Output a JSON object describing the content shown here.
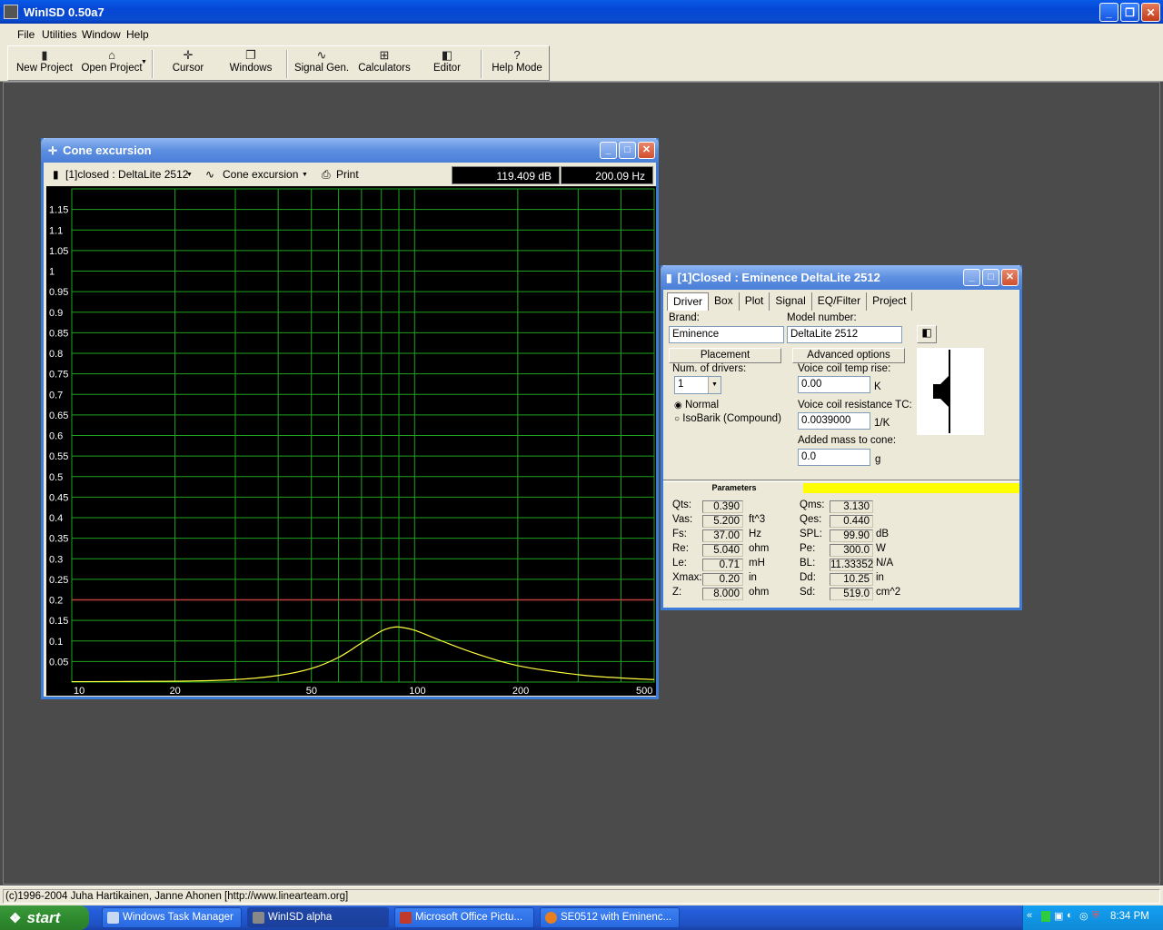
{
  "app": {
    "title": "WinISD 0.50a7"
  },
  "menu": {
    "items": [
      "File",
      "Utilities",
      "Window",
      "Help"
    ]
  },
  "toolbar": {
    "buttons": [
      {
        "label": "New Project",
        "icon": "new-project-icon"
      },
      {
        "label": "Open Project",
        "icon": "open-folder-icon"
      },
      {
        "label": "Cursor",
        "icon": "cursor-crosshair-icon"
      },
      {
        "label": "Windows",
        "icon": "windows-stack-icon"
      },
      {
        "label": "Signal Gen.",
        "icon": "sine-wave-icon"
      },
      {
        "label": "Calculators",
        "icon": "calculator-icon"
      },
      {
        "label": "Editor",
        "icon": "speaker-editor-icon"
      },
      {
        "label": "Help Mode",
        "icon": "help-question-icon"
      }
    ]
  },
  "cone_window": {
    "title": "Cone excursion",
    "project_select": "[1]closed : DeltaLite 2512",
    "graph_select": "Cone excursion",
    "print_label": "Print",
    "readout_db": "119.409 dB",
    "readout_hz": "200.09 Hz"
  },
  "chart_data": {
    "type": "line",
    "title": "",
    "xlabel": "",
    "ylabel": "",
    "x_scale": "log",
    "xlim": [
      10,
      500
    ],
    "ylim": [
      0,
      1.2
    ],
    "x_tick_labels": [
      "10",
      "20",
      "50",
      "100",
      "200",
      "500"
    ],
    "x_ticks": [
      10,
      20,
      50,
      100,
      200,
      500
    ],
    "y_ticks": [
      1.15,
      1.1,
      1.05,
      1,
      0.95,
      0.9,
      0.85,
      0.8,
      0.75,
      0.7,
      0.65,
      0.6,
      0.55,
      0.5,
      0.45,
      0.4,
      0.35,
      0.3,
      0.25,
      0.2,
      0.15,
      0.1,
      0.05
    ],
    "y_tick_labels": [
      "1.15",
      "1.1",
      "1.05",
      "1",
      "0.95",
      "0.9",
      "0.85",
      "0.8",
      "0.75",
      "0.7",
      "0.65",
      "0.6",
      "0.55",
      "0.5",
      "0.45",
      "0.4",
      "0.35",
      "0.3",
      "0.25",
      "0.2",
      "0.15",
      "0.1",
      "0.05"
    ],
    "grid": true,
    "limit_line": {
      "y": 0.2,
      "color": "#c04040"
    },
    "series": [
      {
        "color": "#ffff40",
        "x": [
          10,
          20,
          30,
          40,
          50,
          60,
          70,
          80,
          85,
          90,
          100,
          120,
          150,
          200,
          300,
          400,
          500
        ],
        "y": [
          0.001,
          0.002,
          0.006,
          0.016,
          0.033,
          0.06,
          0.095,
          0.124,
          0.132,
          0.134,
          0.126,
          0.1,
          0.07,
          0.04,
          0.018,
          0.01,
          0.006
        ]
      }
    ],
    "colors": {
      "background": "#000000",
      "grid": "#1fa31f",
      "axis_text": "#ffffff"
    }
  },
  "driver_window": {
    "title": "[1]Closed : Eminence  DeltaLite 2512",
    "tabs": [
      "Driver",
      "Box",
      "Plot",
      "Signal",
      "EQ/Filter",
      "Project"
    ],
    "active_tab": "Driver",
    "brand_label": "Brand:",
    "brand_value": "Eminence",
    "model_label": "Model number:",
    "model_value": "DeltaLite 2512",
    "placement_label": "Placement",
    "advanced_label": "Advanced options",
    "num_drivers_label": "Num. of drivers:",
    "num_drivers_value": "1",
    "radio_normal": "Normal",
    "radio_isobarik": "IsoBarik (Compound)",
    "vc_temp_label": "Voice coil temp rise:",
    "vc_temp_value": "0.00",
    "vc_temp_unit": "K",
    "vc_tc_label": "Voice coil resistance TC:",
    "vc_tc_value": "0.0039000",
    "vc_tc_unit": "1/K",
    "added_mass_label": "Added mass to cone:",
    "added_mass_value": "0.0",
    "added_mass_unit": "g",
    "params_header": "Parameters",
    "params_left": [
      {
        "name": "Qts:",
        "value": "0.390",
        "unit": ""
      },
      {
        "name": "Vas:",
        "value": "5.200",
        "unit": "ft^3"
      },
      {
        "name": "Fs:",
        "value": "37.00",
        "unit": "Hz"
      },
      {
        "name": "Re:",
        "value": "5.040",
        "unit": "ohm"
      },
      {
        "name": "Le:",
        "value": "0.71",
        "unit": "mH"
      },
      {
        "name": "Xmax:",
        "value": "0.20",
        "unit": "in"
      },
      {
        "name": "Z:",
        "value": "8.000",
        "unit": "ohm"
      }
    ],
    "params_right": [
      {
        "name": "Qms:",
        "value": "3.130",
        "unit": ""
      },
      {
        "name": "Qes:",
        "value": "0.440",
        "unit": ""
      },
      {
        "name": "SPL:",
        "value": "99.90",
        "unit": "dB"
      },
      {
        "name": "Pe:",
        "value": "300.0",
        "unit": "W"
      },
      {
        "name": "BL:",
        "value": "11.33352",
        "unit": "N/A"
      },
      {
        "name": "Dd:",
        "value": "10.25",
        "unit": "in"
      },
      {
        "name": "Sd:",
        "value": "519.0",
        "unit": "cm^2"
      }
    ]
  },
  "status": {
    "text": "(c)1996-2004 Juha Hartikainen, Janne Ahonen [http://www.linearteam.org]"
  },
  "taskbar": {
    "start_label": "start",
    "tasks": [
      {
        "label": "Windows Task Manager",
        "icon": "task-manager-icon"
      },
      {
        "label": "WinISD alpha",
        "icon": "winisd-icon"
      },
      {
        "label": "Microsoft Office Pictu...",
        "icon": "office-picture-icon"
      },
      {
        "label": "SE0512 with Eminenc...",
        "icon": "firefox-icon"
      }
    ],
    "clock": "8:34 PM"
  }
}
